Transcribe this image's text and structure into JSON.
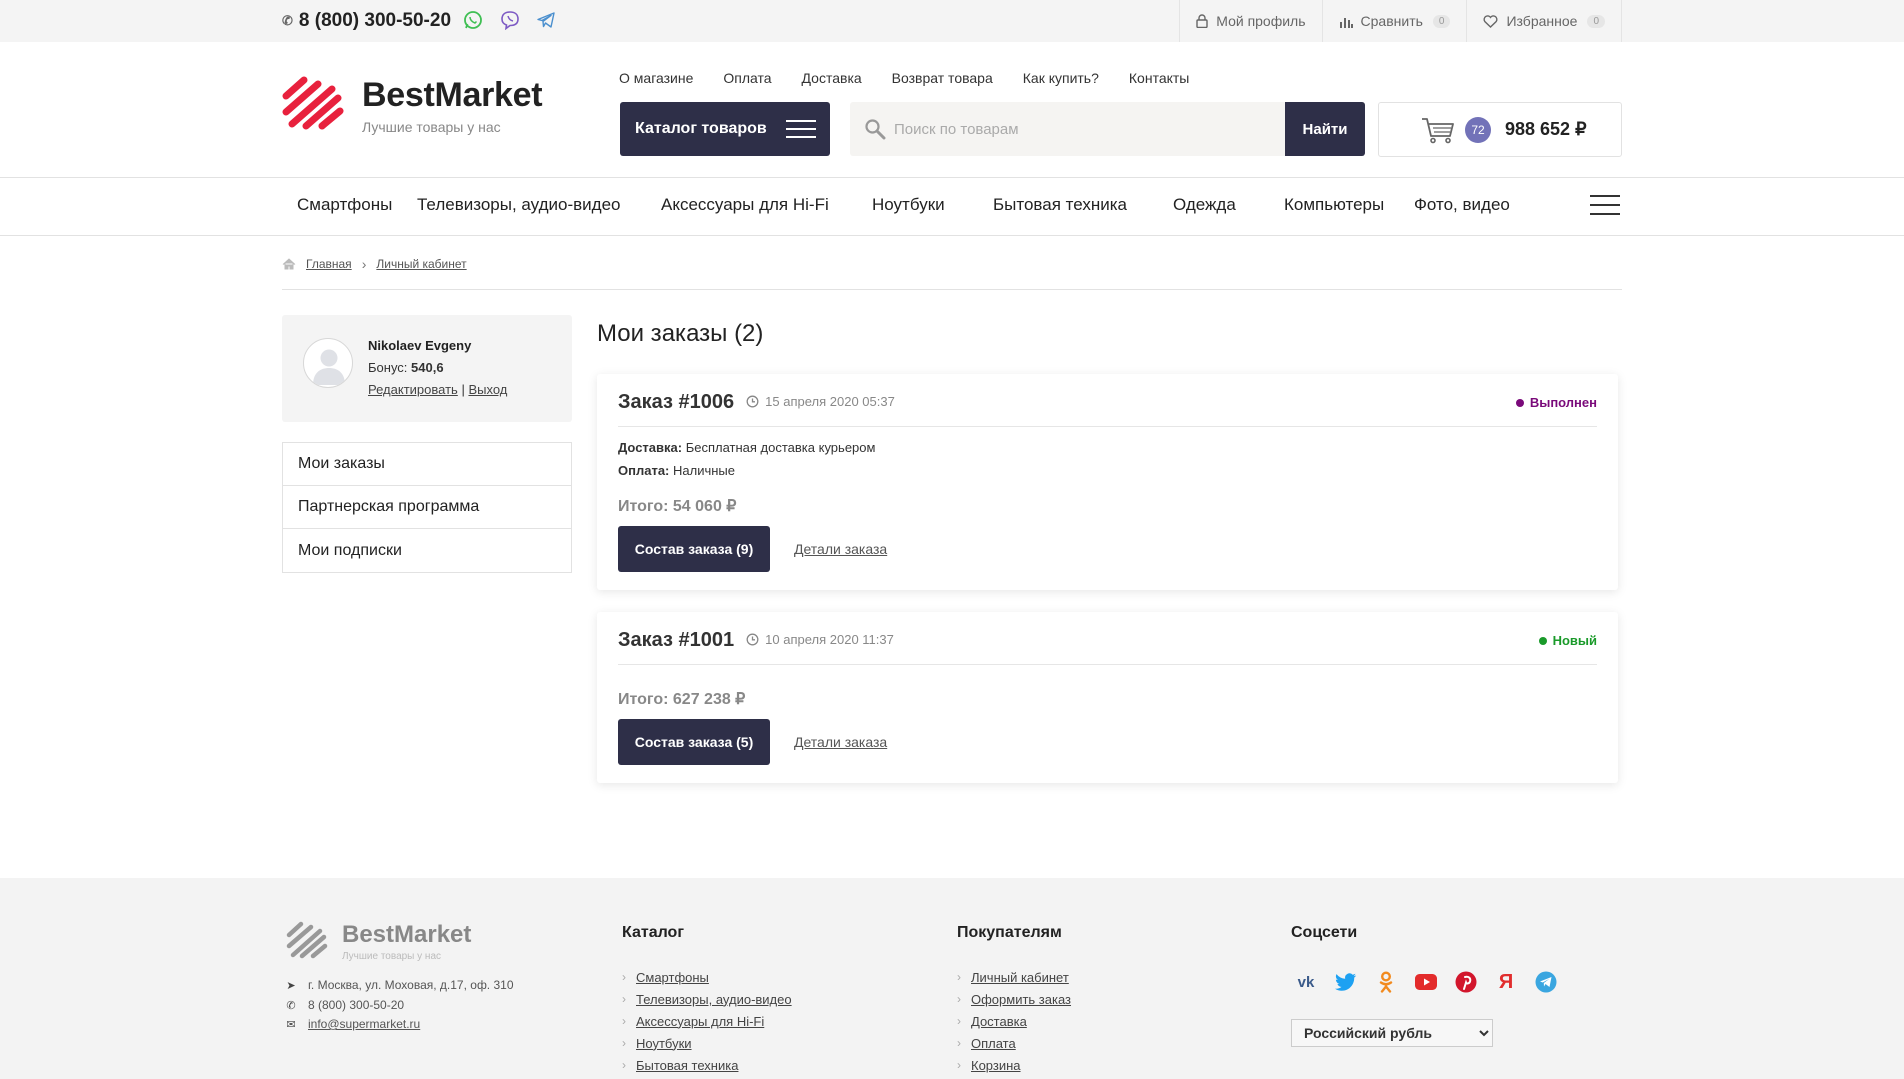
{
  "topbar": {
    "phone": "8 (800) 300-50-20",
    "profile": "Мой профиль",
    "compare": "Сравнить",
    "compare_count": "0",
    "favorites": "Избранное",
    "favorites_count": "0"
  },
  "header": {
    "brand": "BestMarket",
    "slogan": "Лучшие товары у нас",
    "nav": [
      "О магазине",
      "Оплата",
      "Доставка",
      "Возврат товара",
      "Как купить?",
      "Контакты"
    ],
    "catalog_button": "Каталог товаров",
    "search_placeholder": "Поиск по товарам",
    "search_button": "Найти",
    "cart_count": "72",
    "cart_total": "988 652 ₽"
  },
  "catnav": [
    "Смартфоны",
    "Телевизоры, аудио-видео",
    "Аксессуары для Hi-Fi",
    "Ноутбуки",
    "Бытовая техника",
    "Одежда",
    "Компьютеры",
    "Фото, видео"
  ],
  "breadcrumbs": [
    "Главная",
    "Личный кабинет"
  ],
  "profile": {
    "name": "Nikolaev Evgeny",
    "bonus_label": "Бонус:",
    "bonus_value": "540,6",
    "edit": "Редактировать",
    "separator": "|",
    "logout": "Выход"
  },
  "sidebar": [
    "Мои заказы",
    "Партнерская программа",
    "Мои подписки"
  ],
  "main": {
    "title": "Мои заказы (2)",
    "orders": [
      {
        "number": "Заказ #1006",
        "date": "15 апреля 2020 05:37",
        "status": "Выполнен",
        "status_color": "#7a0a7a",
        "delivery_label": "Доставка:",
        "delivery_value": "Бесплатная доставка курьером",
        "payment_label": "Оплата:",
        "payment_value": "Наличные",
        "total": "Итого: 54 060 ₽",
        "items_button": "Состав заказа (9)",
        "details_link": "Детали заказа"
      },
      {
        "number": "Заказ #1001",
        "date": "10 апреля 2020 11:37",
        "status": "Новый",
        "status_color": "#1a9a2a",
        "total": "Итого: 627 238 ₽",
        "items_button": "Состав заказа (5)",
        "details_link": "Детали заказа"
      }
    ]
  },
  "footer": {
    "brand": "BestMarket",
    "slogan": "Лучшие товары у нас",
    "address": "г. Москва, ул. Моховая, д.17, оф. 310",
    "phone": "8 (800) 300-50-20",
    "email": "info@supermarket.ru",
    "catalog_title": "Каталог",
    "catalog": [
      "Смартфоны",
      "Телевизоры, аудио-видео",
      "Аксессуары для Hi-Fi",
      "Ноутбуки",
      "Бытовая техника"
    ],
    "customers_title": "Покупателям",
    "customers": [
      "Личный кабинет",
      "Оформить заказ",
      "Доставка",
      "Оплата",
      "Корзина"
    ],
    "social_title": "Соцсети",
    "social_icons": [
      "vk-icon",
      "twitter-icon",
      "odnoklassniki-icon",
      "youtube-icon",
      "pinterest-icon",
      "yandex-icon",
      "telegram-icon"
    ],
    "currency": "Российский рубль"
  },
  "colors": {
    "primary_dark": "#2e2f48",
    "brand_red": "#e8213d",
    "cart_badge": "#7272b8"
  }
}
